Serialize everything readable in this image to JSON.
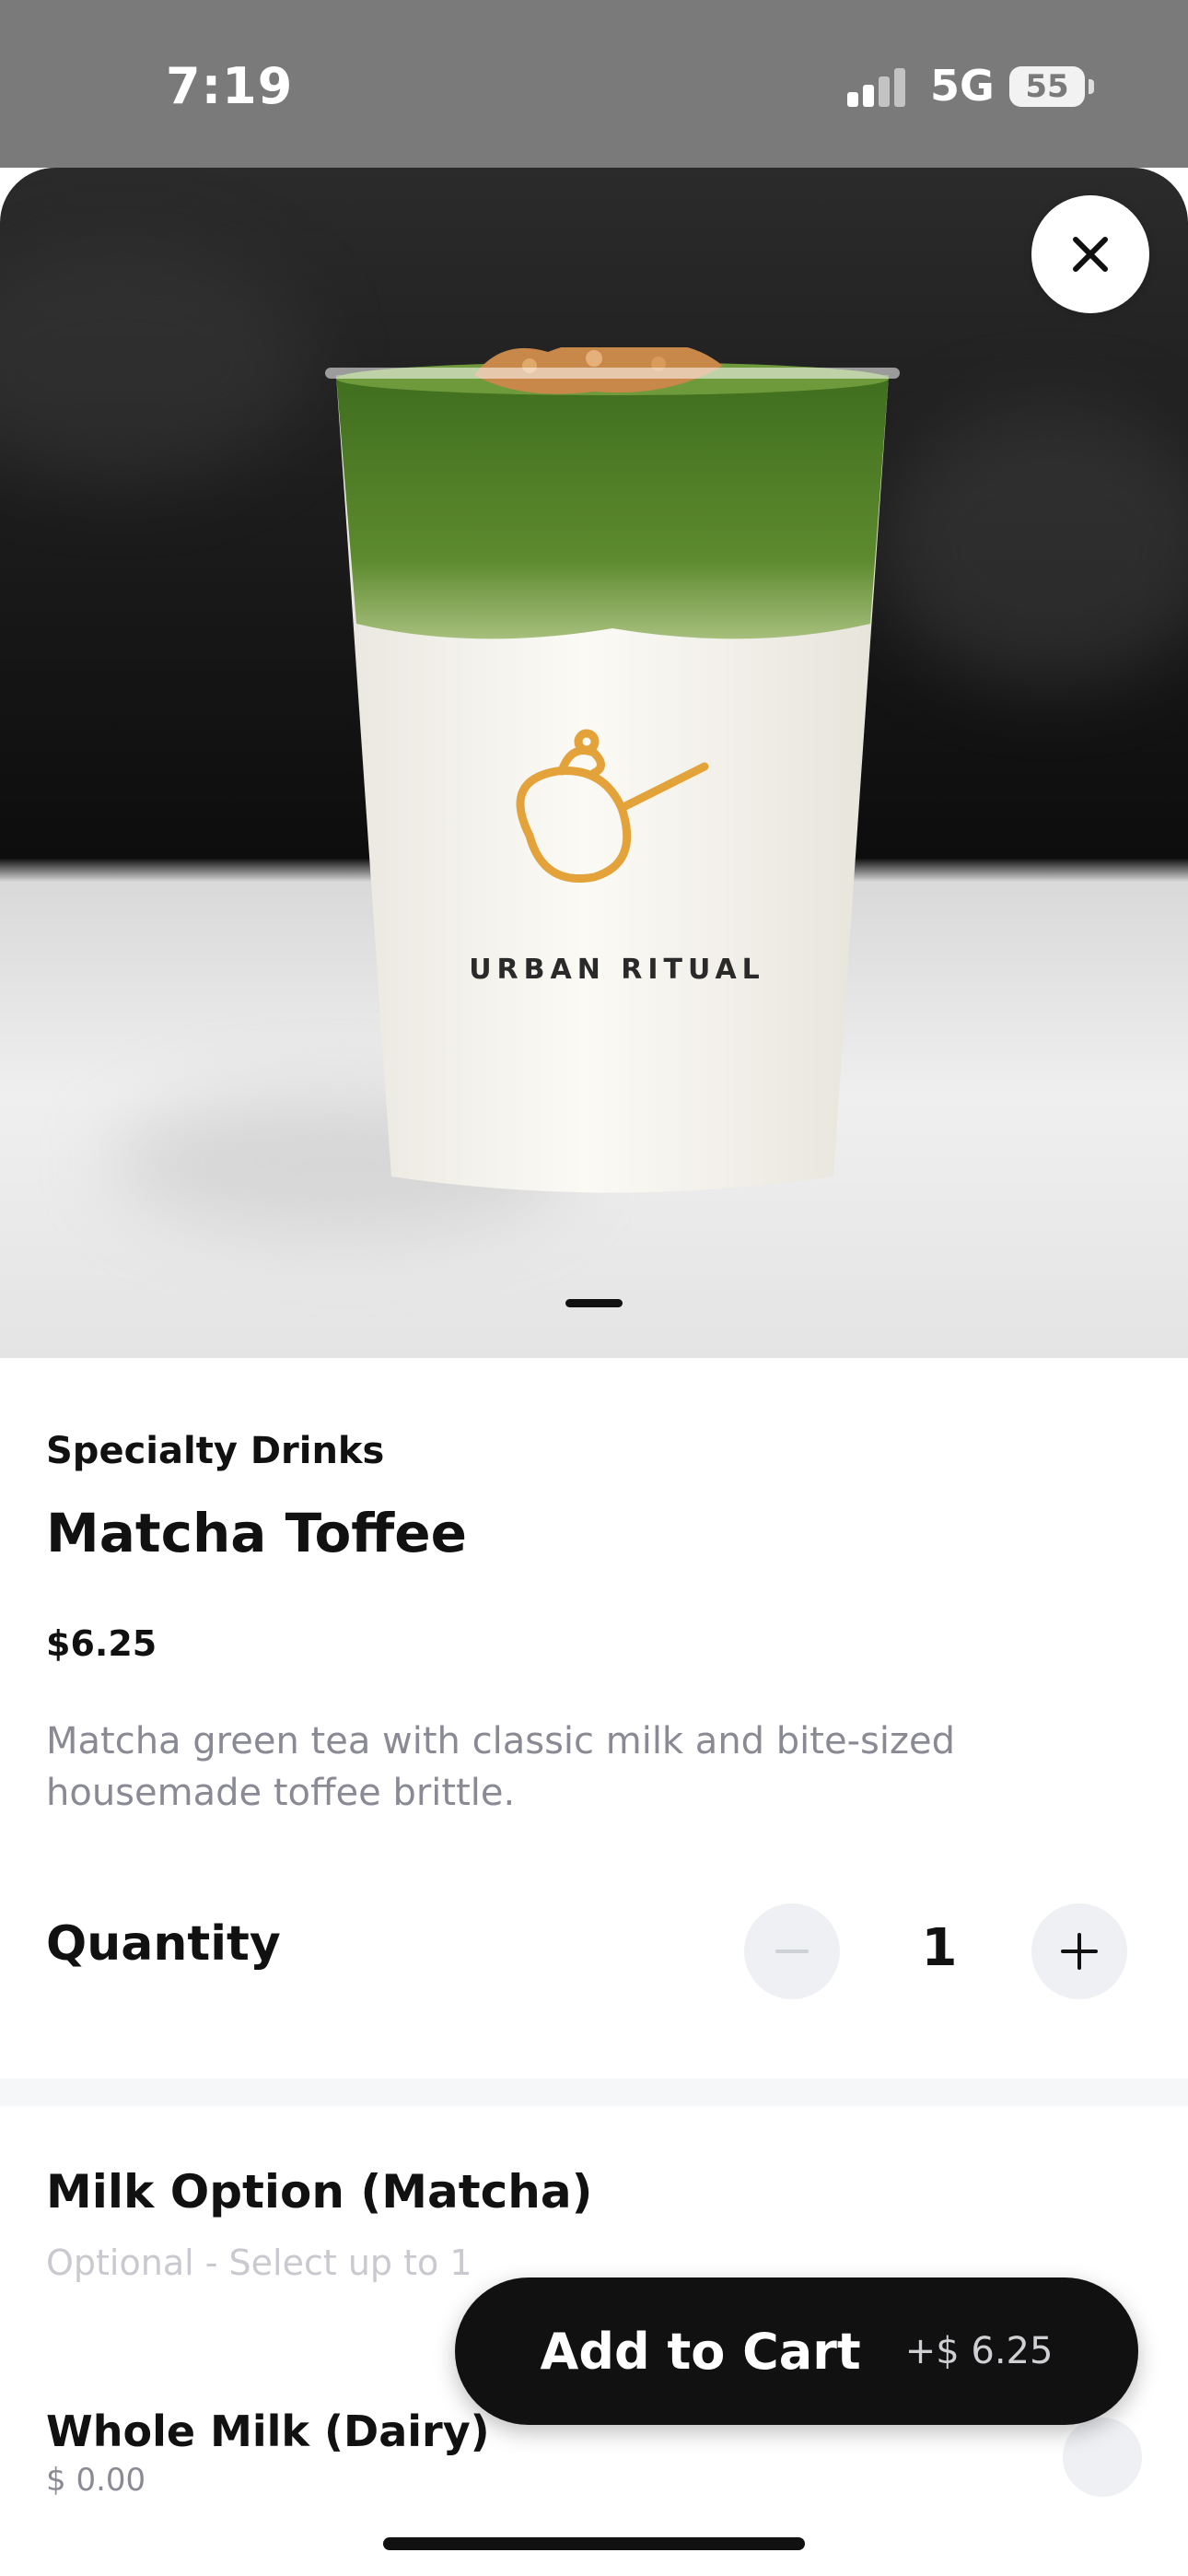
{
  "status_bar": {
    "time": "7:19",
    "network": "5G",
    "battery": "55"
  },
  "product": {
    "image_brand_text": "URBAN RITUAL",
    "category": "Specialty Drinks",
    "name": "Matcha Toffee",
    "price": "$6.25",
    "description": "Matcha green tea with classic milk and bite-sized housemade toffee brittle."
  },
  "quantity": {
    "label": "Quantity",
    "value": "1",
    "decrement_symbol": "−",
    "increment_symbol": "+"
  },
  "option_group": {
    "title": "Milk Option (Matcha)",
    "subtitle": "Optional - Select up to 1",
    "options": [
      {
        "name": "Whole Milk (Dairy)",
        "price": "$ 0.00"
      }
    ]
  },
  "cart_button": {
    "label": "Add to Cart",
    "price": "+$ 6.25"
  },
  "icons": {
    "close": "close-icon",
    "minus": "minus-icon",
    "plus": "plus-icon"
  },
  "colors": {
    "accent_dark": "#111111",
    "muted_text": "#8a8a95",
    "stepper_bg": "#eef0f4",
    "matcha_green": "#4f7a2a",
    "logo_gold": "#e3a33a"
  }
}
